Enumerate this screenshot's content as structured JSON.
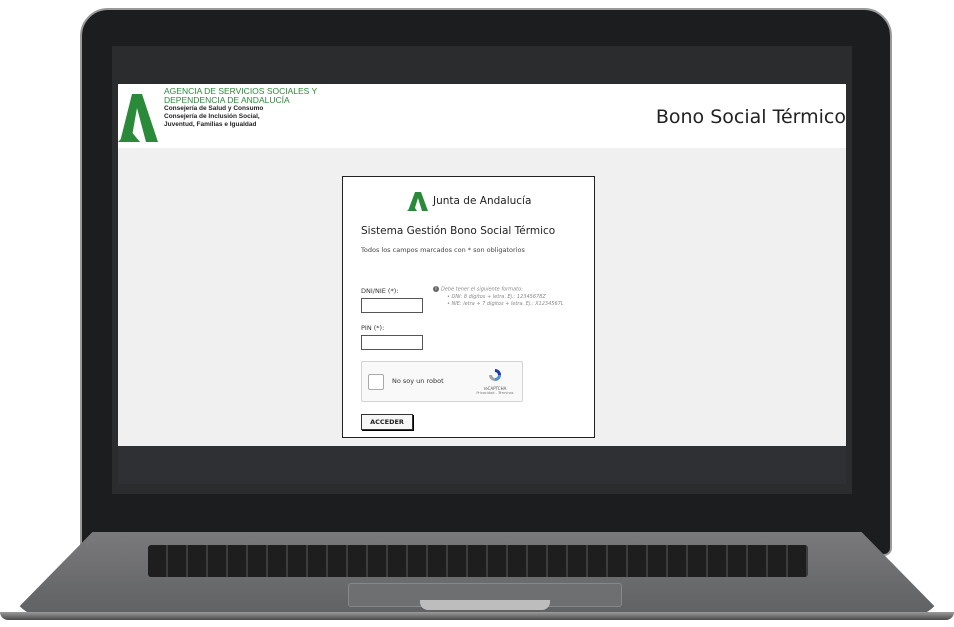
{
  "header": {
    "agency_line1": "AGENCIA DE SERVICIOS SOCIALES Y",
    "agency_line2": "DEPENDENCIA DE ANDALUCÍA",
    "dept_line1": "Consejería de Salud y Consumo",
    "dept_line2": "Consejería de Inclusión Social,",
    "dept_line3": "Juventud, Familias e Igualdad",
    "page_title": "Bono Social Térmico"
  },
  "login": {
    "brand_name": "Junta de Andalucía",
    "system_title": "Sistema Gestión Bono Social Térmico",
    "required_note": "Todos los campos marcados con * son obligatorios",
    "dni_label": "DNI/NIE (*):",
    "dni_value": "",
    "hint_title": "Debe tener el siguiente formato:",
    "hint_dni": "DNI: 8 dígitos + letra. Ej.: 12345678Z",
    "hint_nie": "NIE: letra + 7 dígitos + letra. Ej.: X1234567L",
    "pin_label": "PIN (*):",
    "pin_value": "",
    "captcha_label": "No soy un robot",
    "captcha_brand": "reCAPTCHA",
    "captcha_links": "Privacidad - Términos",
    "submit_label": "ACCEDER"
  },
  "colors": {
    "brand_green": "#2a8a3a",
    "laptop_bezel": "#1c1d1f",
    "screen_bg": "#f0f0f0"
  }
}
